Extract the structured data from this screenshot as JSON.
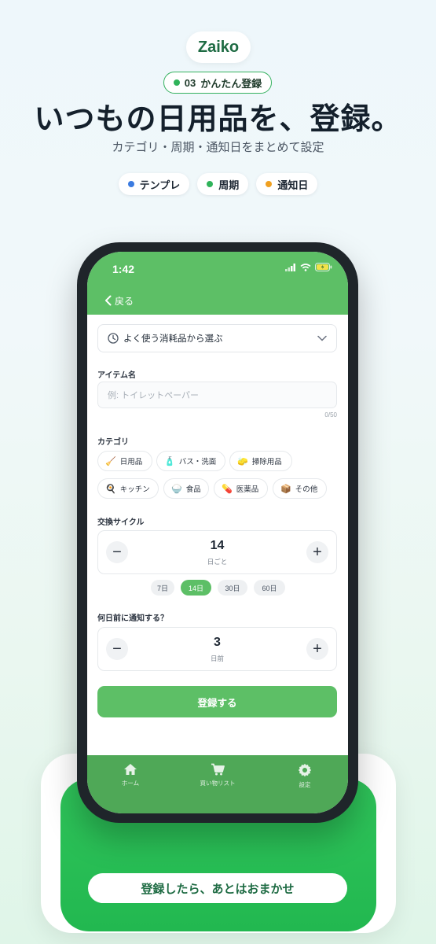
{
  "promo": {
    "logo": "Zaiko",
    "step_number": "03",
    "step_label": "かんたん登録",
    "headline": "いつもの日用品を、登録。",
    "subheadline": "カテゴリ・周期・通知日をまとめて設定",
    "features": [
      {
        "label": "テンプレ",
        "color": "#3b7be0"
      },
      {
        "label": "周期",
        "color": "#2fb35a"
      },
      {
        "label": "通知日",
        "color": "#f0a020"
      }
    ],
    "cta": "登録したら、あとはおまかせ"
  },
  "status_bar": {
    "time": "1:42"
  },
  "nav": {
    "back_label": "戻る"
  },
  "form": {
    "template_select": "よく使う消耗品から選ぶ",
    "item_name_label": "アイテム名",
    "item_name_placeholder": "例: トイレットペーパー",
    "item_name_counter": "0/50",
    "category_label": "カテゴリ",
    "categories": [
      {
        "label": "日用品",
        "icon": "🧹"
      },
      {
        "label": "バス・洗面",
        "icon": "🧴"
      },
      {
        "label": "掃除用品",
        "icon": "🧽"
      },
      {
        "label": "キッチン",
        "icon": "🍳"
      },
      {
        "label": "食品",
        "icon": "🍚"
      },
      {
        "label": "医薬品",
        "icon": "💊"
      },
      {
        "label": "その他",
        "icon": "📦"
      }
    ],
    "cycle_label": "交換サイクル",
    "cycle_value": "14",
    "cycle_unit": "日ごと",
    "cycle_presets": [
      "7日",
      "14日",
      "30日",
      "60日"
    ],
    "cycle_active_preset": "14日",
    "notify_label": "何日前に通知する？",
    "notify_value": "3",
    "notify_unit": "日前",
    "submit_label": "登録する"
  },
  "tabbar": {
    "items": [
      {
        "label": "ホーム",
        "icon": "home-icon"
      },
      {
        "label": "買い物リスト",
        "icon": "cart-icon"
      },
      {
        "label": "設定",
        "icon": "gear-icon"
      }
    ]
  },
  "colors": {
    "brand_green": "#5dbf66",
    "cta_green": "#22b850",
    "tab_green": "#4fa857"
  }
}
